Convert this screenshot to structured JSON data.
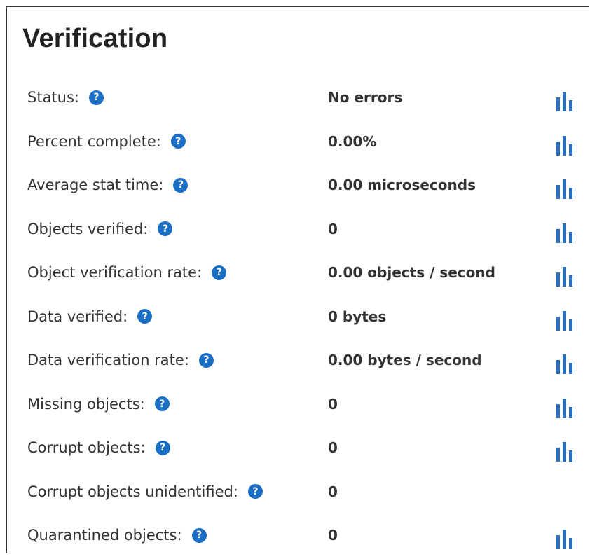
{
  "title": "Verification",
  "colors": {
    "help_icon": "#1a6ec4",
    "chart_icon": "#2a6fc0",
    "text": "#333333"
  },
  "rows": [
    {
      "label": "Status:",
      "value": "No errors",
      "chart": true
    },
    {
      "label": "Percent complete:",
      "value": "0.00%",
      "chart": true
    },
    {
      "label": "Average stat time:",
      "value": "0.00 microseconds",
      "chart": true
    },
    {
      "label": "Objects verified:",
      "value": "0",
      "chart": true
    },
    {
      "label": "Object verification rate:",
      "value": "0.00 objects / second",
      "chart": true
    },
    {
      "label": "Data verified:",
      "value": "0 bytes",
      "chart": true
    },
    {
      "label": "Data verification rate:",
      "value": "0.00 bytes / second",
      "chart": true
    },
    {
      "label": "Missing objects:",
      "value": "0",
      "chart": true
    },
    {
      "label": "Corrupt objects:",
      "value": "0",
      "chart": true
    },
    {
      "label": "Corrupt objects unidentified:",
      "value": "0",
      "chart": false
    },
    {
      "label": "Quarantined objects:",
      "value": "0",
      "chart": true
    }
  ],
  "icons": {
    "help": "question-circle-icon",
    "chart": "bar-chart-icon"
  },
  "help_glyph": "?"
}
